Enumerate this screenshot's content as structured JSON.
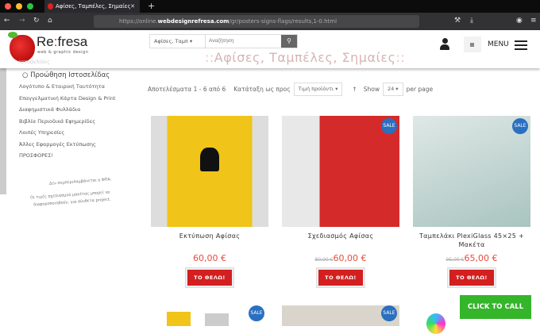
{
  "browser": {
    "tab_title": "Αφίσες, Ταμπέλες, Σημαίες",
    "url_prefix": "https://online.",
    "url_domain": "webdesignrefresa.com",
    "url_path": "/gr/posters-signs-flags/results,1-0.html"
  },
  "header": {
    "logo_main": "Re",
    "logo_colon": ":",
    "logo_rest": "fresa",
    "logo_sub": "web & graphic design",
    "search_category": "Αφίσες, Ταμπ ▾",
    "search_placeholder": "Αναζήτηση",
    "menu_label": "MENU",
    "page_title": "Αφίσες, Ταμπέλες, Σημαίες",
    "title_prefix": "::",
    "title_suffix": "::"
  },
  "sidebar": {
    "faded_item": "Ιστοσελίδες",
    "promo": "○ Προώθηση Ιστοσελίδας",
    "items": [
      "Λογότυπο & Εταιρική Ταυτότητα",
      "Επαγγελματική Κάρτα Design & Print",
      "Διαφημιστικά Φυλλάδια",
      "Βιβλία Περιοδικά Εφημερίδες",
      "Λοιπές Υπηρεσίες",
      "Άλλες Εφαρμογές Εκτύπωσης",
      "ΠΡΟΣΦΟΡΕΣ!"
    ],
    "note1": "Δεν συμπεριλαμβάνεται ο ΦΠΑ.",
    "note2": "Οι τιμές σχεδιασμού μακέτας μπορεί να",
    "note3": "διαφοροποιηθούν, για σύνθετα project."
  },
  "toolbar": {
    "results": "Αποτελέσματα 1 - 6 από 6",
    "sort_label": "Κατάταξη ως προς",
    "sort_value": "Τιμή προϊόντι ▾",
    "sort_dir": "↑",
    "show_label": "Show",
    "show_value": "24  ▾",
    "per_page": "per page"
  },
  "products": [
    {
      "name": "Εκτύπωση Αφίσας",
      "old_price": "",
      "price": "60,00 €",
      "button": "ΤΟ ΘΕΛΩ!",
      "sale": ""
    },
    {
      "name": "Σχεδιασμός Αφίσας",
      "old_price": "80,00 €",
      "price": "60,00 €",
      "button": "ΤΟ ΘΕΛΩ!",
      "sale": "SALE"
    },
    {
      "name": "Ταμπελάκι PlexiGlass 45×25 + Μακέτα",
      "old_price": "95,00 €",
      "price": "65,00 €",
      "button": "ΤΟ ΘΕΛΩ!",
      "sale": "SALE"
    }
  ],
  "row2_sale": "SALE",
  "call_button": "CLICK TO CALL"
}
